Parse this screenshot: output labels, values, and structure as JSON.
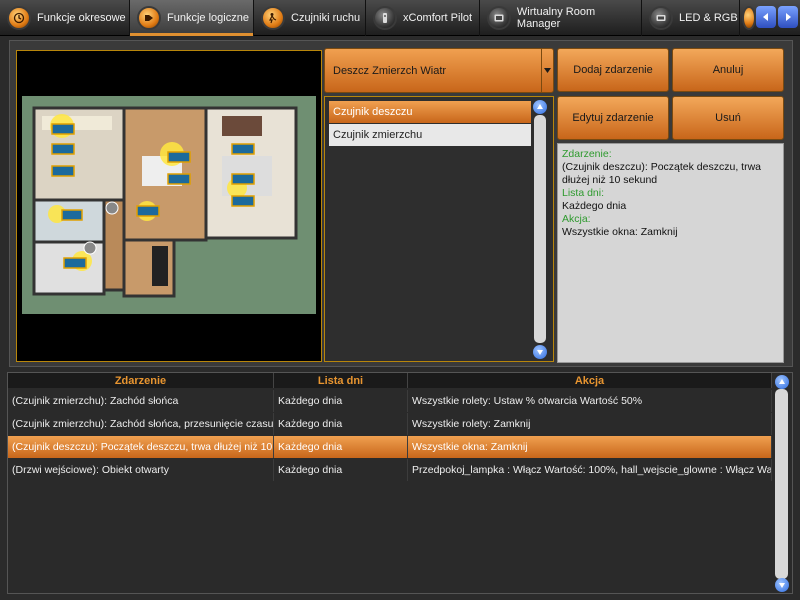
{
  "tabs": [
    {
      "label": "Funkcje okresowe",
      "icon": "clock-icon"
    },
    {
      "label": "Funkcje logiczne",
      "icon": "logic-icon"
    },
    {
      "label": "Czujniki ruchu",
      "icon": "motion-sensor-icon"
    },
    {
      "label": "xComfort Pilot",
      "icon": "remote-icon"
    },
    {
      "label": "Wirtualny Room Manager",
      "icon": "room-manager-icon"
    },
    {
      "label": "LED & RGB",
      "icon": "led-icon"
    }
  ],
  "event_select": {
    "value": "Deszcz Zmierzch Wiatr"
  },
  "event_list": [
    "Czujnik deszczu",
    "Czujnik zmierzchu"
  ],
  "buttons": {
    "add": "Dodaj zdarzenie",
    "cancel": "Anuluj",
    "edit": "Edytuj zdarzenie",
    "delete": "Usuń"
  },
  "details": {
    "event_label": "Zdarzenie:",
    "event_value": "(Czujnik deszczu): Początek deszczu, trwa dłużej niż 10 sekund",
    "days_label": "Lista dni:",
    "days_value": "Każdego dnia",
    "action_label": "Akcja:",
    "action_value": "Wszystkie okna: Zamknij"
  },
  "table": {
    "headers": [
      "Zdarzenie",
      "Lista dni",
      "Akcja"
    ],
    "rows": [
      [
        "(Czujnik zmierzchu): Zachód słońca",
        "Każdego dnia",
        "Wszystkie rolety: Ustaw % otwarcia Wartość 50%"
      ],
      [
        "(Czujnik zmierzchu): Zachód słońca, przesunięcie czasu:...",
        "Każdego dnia",
        "Wszystkie rolety: Zamknij"
      ],
      [
        "(Czujnik deszczu): Początek deszczu, trwa dłużej niż 10 ...",
        "Każdego dnia",
        "Wszystkie okna: Zamknij"
      ],
      [
        "(Drzwi wejściowe): Obiekt otwarty",
        "Każdego dnia",
        "Przedpokoj_lampka : Włącz Wartość: 100%, hall_wejscie_glowne : Włącz Wart..."
      ]
    ],
    "selected_row": 2
  },
  "colors": {
    "accent": "#e08a2c",
    "selected": "#d9782a",
    "label_green": "#2e9a2e"
  }
}
